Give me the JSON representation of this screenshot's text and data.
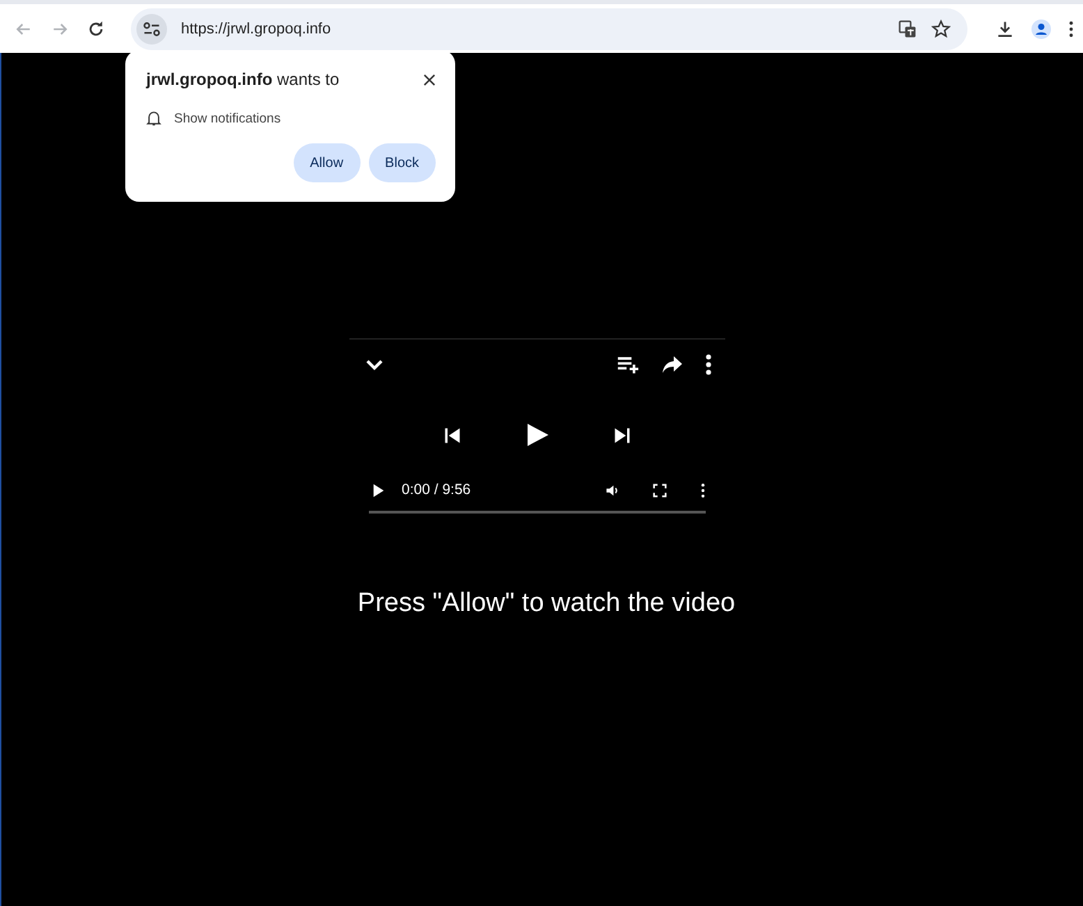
{
  "browser": {
    "url": "https://jrwl.gropoq.info"
  },
  "permission_prompt": {
    "site": "jrwl.gropoq.info",
    "suffix": "wants to",
    "permission": "Show notifications",
    "buttons": [
      "Allow",
      "Block"
    ]
  },
  "player": {
    "time": "0:00 / 9:56",
    "level": 0
  },
  "message": "Press \"Allow\" to watch the video"
}
